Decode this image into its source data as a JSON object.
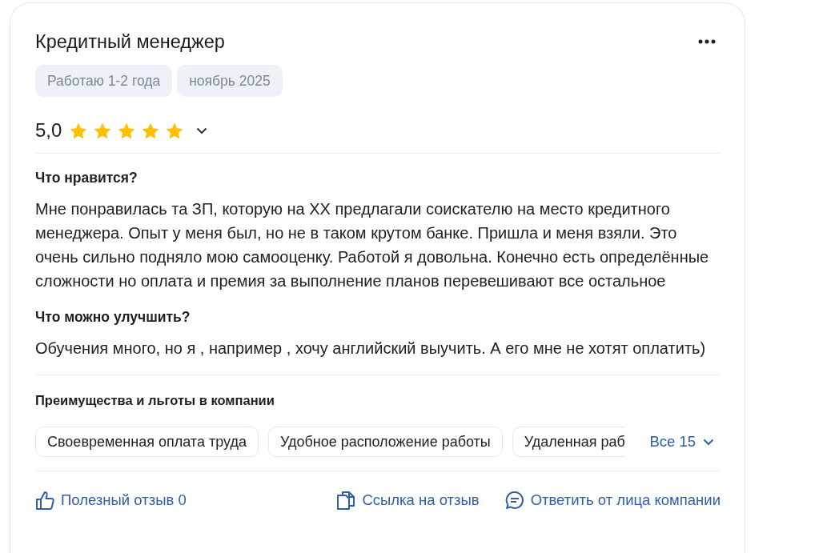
{
  "review": {
    "title": "Кредитный менеджер",
    "tags": [
      "Работаю 1-2 года",
      "ноябрь 2025"
    ],
    "rating": "5,0",
    "stars": 5,
    "sections": [
      {
        "heading": "Что нравится?",
        "text": "Мне понравилась та ЗП, которую на XX предлагали соискателю на место кредитного менеджера. Опыт у меня был, но не в таком крутом банке. Пришла и меня взяли. Это очень сильно подняло мою самооценку. Работой я довольна. Конечно есть определённые сложности но оплата и премия за выполнение планов перевешивают все остальное"
      },
      {
        "heading": "Что можно улучшить?",
        "text": "Обучения много, но я , например , хочу английский выучить. А его мне не хотят оплатить)"
      }
    ],
    "benefits": {
      "heading": "Преимущества и льготы в компании",
      "items": [
        {
          "label": "Своевременная оплата труда",
          "cut": false
        },
        {
          "label": "Удобное расположение работы",
          "cut": false
        },
        {
          "label": "Удаленная раб",
          "cut": true
        }
      ],
      "more": "Все 15"
    },
    "actions": [
      {
        "kind": "like",
        "label": "Полезный отзыв 0"
      },
      {
        "kind": "link",
        "label": "Ссылка на отзыв"
      },
      {
        "kind": "reply",
        "label": "Ответить от лица компании"
      }
    ]
  }
}
